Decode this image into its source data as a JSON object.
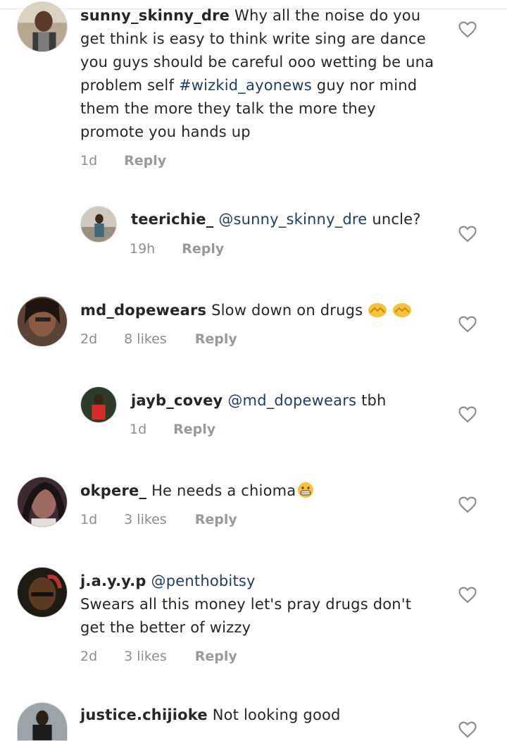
{
  "comments": [
    {
      "username": "sunny_skinny_dre",
      "text": "Why all the noise do you get think is easy to think write sing are dance you guys should be careful ooo wetting be una problem self",
      "hashtag": "#wizkid_ayonews",
      "text_after": "guy nor mind them the more they talk the more they promote you hands up",
      "time": "1d",
      "reply": "Reply"
    },
    {
      "username": "teerichie_",
      "mention": "@sunny_skinny_dre",
      "text": "uncle?",
      "time": "19h",
      "reply": "Reply"
    },
    {
      "username": "md_dopewears",
      "text": "Slow down on drugs",
      "time": "2d",
      "likes": "8 likes",
      "reply": "Reply"
    },
    {
      "username": "jayb_covey",
      "mention": "@md_dopewears",
      "text": "tbh",
      "time": "1d",
      "reply": "Reply"
    },
    {
      "username": "okpere_",
      "text": "He needs a chioma",
      "time": "1d",
      "likes": "3 likes",
      "reply": "Reply"
    },
    {
      "username": "j.a.y.y.p",
      "mention": "@penthobitsy",
      "text": "Swears all this money let's pray drugs don't get the better of wizzy",
      "time": "2d",
      "likes": "3 likes",
      "reply": "Reply"
    },
    {
      "username": "justice.chijioke",
      "text": "Not looking good"
    }
  ],
  "icons": {
    "like": "heart-outline-icon",
    "emoji_hands": "covering-hands-emoji-icon",
    "emoji_grin": "grimacing-emoji-icon"
  },
  "colors": {
    "text": "#262626",
    "mention": "#1d3f66",
    "meta": "#8e8e8e"
  }
}
